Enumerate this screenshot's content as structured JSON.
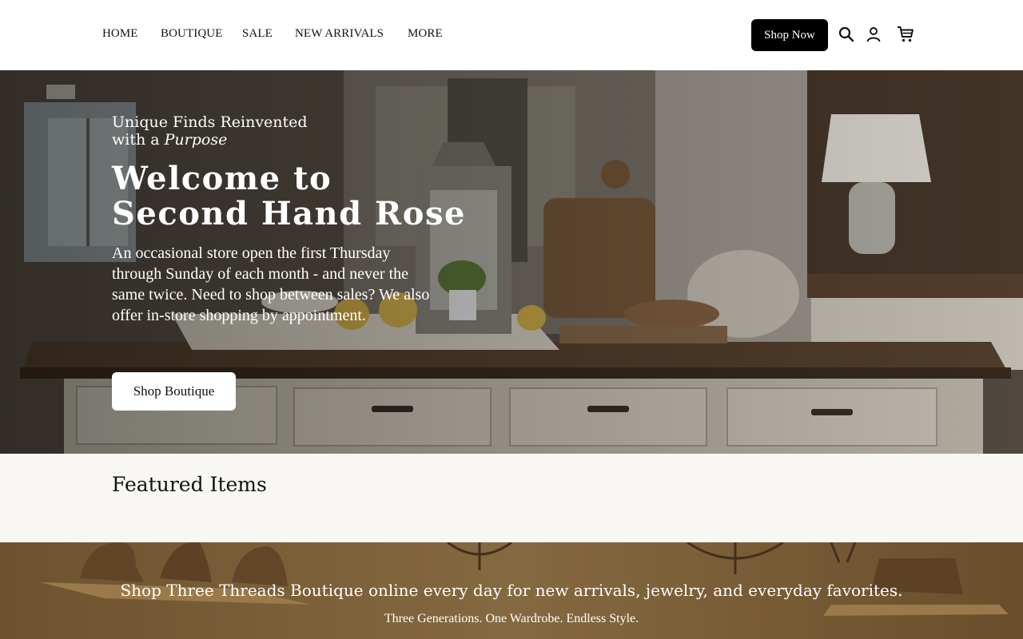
{
  "nav": {
    "items": [
      {
        "label": "HOME"
      },
      {
        "label": "BOUTIQUE"
      },
      {
        "label": "SALE"
      },
      {
        "label": "NEW ARRIVALS"
      },
      {
        "label": "MORE"
      }
    ],
    "shop_now_label": "Shop Now",
    "icons": [
      "search-icon",
      "account-icon",
      "cart-icon"
    ]
  },
  "hero": {
    "tagline_line1": "Unique Finds Reinvented",
    "tagline_line2_prefix": "with a",
    "tagline_line2_emphasis": "Purpose",
    "welcome_bold": "Welcome",
    "welcome_rest": "to",
    "welcome_line2": "Second Hand Rose",
    "description": "An occasional store open the first Thursday through Sunday of each month - and never the same twice. Need to shop between sales? We also offer in-store shopping by appointment.",
    "cta_label": "Shop Boutique"
  },
  "featured": {
    "heading": "Featured Items"
  },
  "banner": {
    "title": "Shop Three Threads Boutique online every day for new arrivals, jewelry, and everyday favorites.",
    "subtitle": "Three Generations. One Wardrobe. Endless Style."
  },
  "colors": {
    "header_bg": "#ffffff",
    "button_dark": "#000000",
    "featured_bg": "#f8f7f4",
    "banner_tone": "#8a6a3f"
  }
}
